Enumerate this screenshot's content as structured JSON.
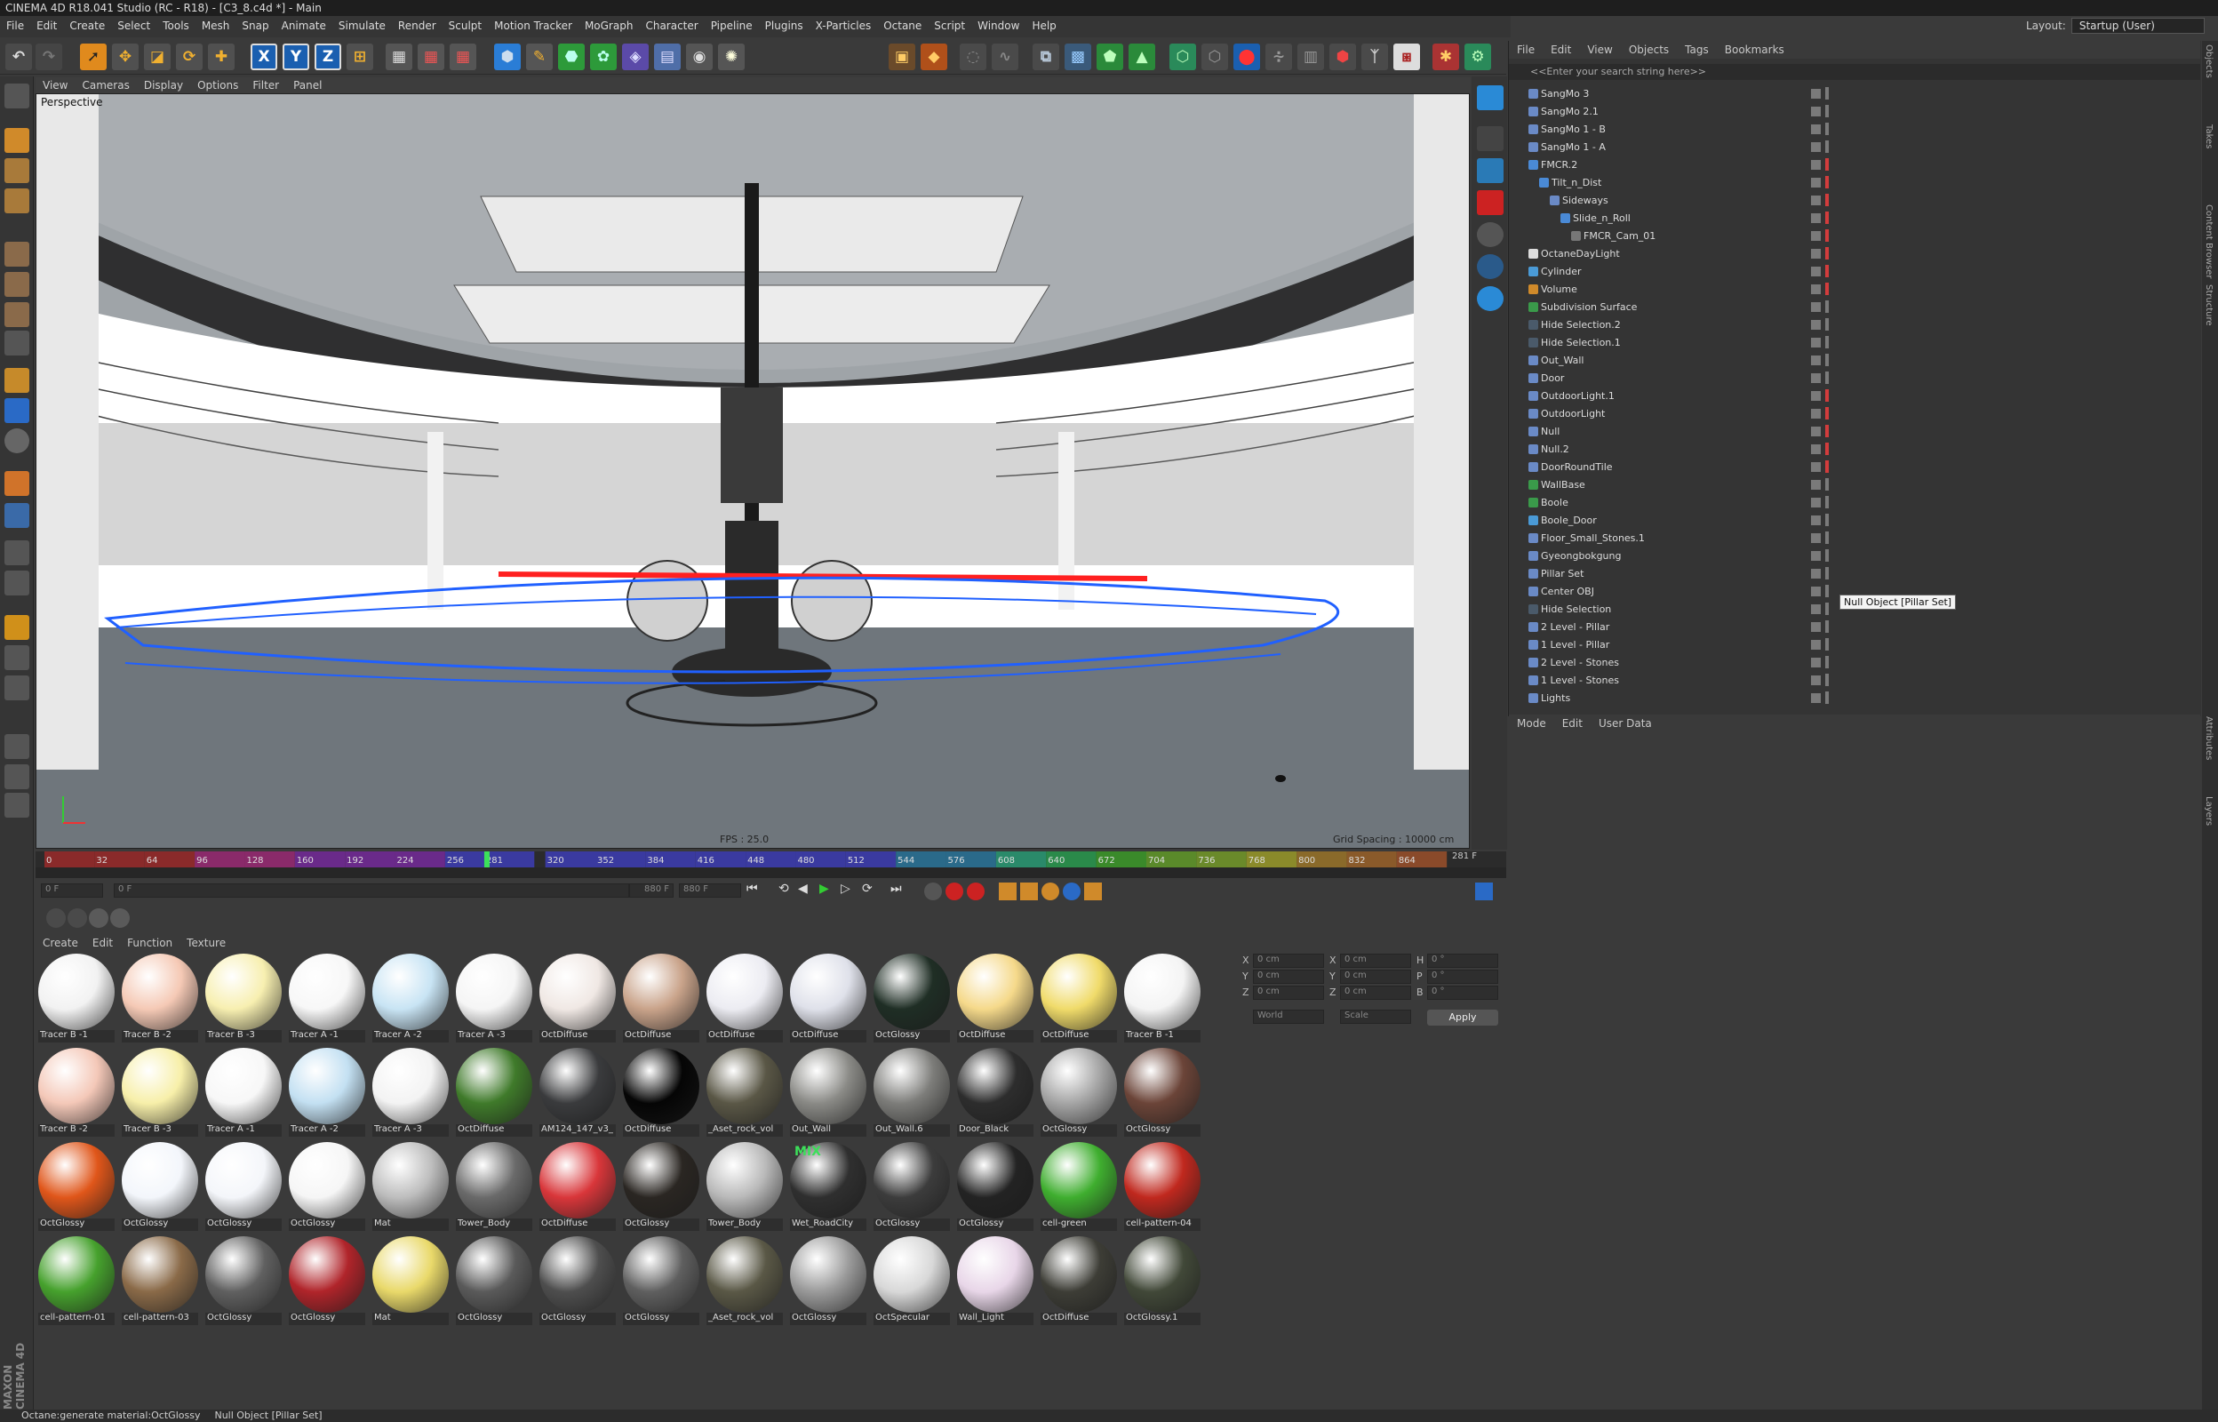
{
  "app": {
    "title": "CINEMA 4D R18.041 Studio (RC - R18) - [C3_8.c4d *] - Main",
    "logo": "MAXON CINEMA 4D"
  },
  "menubar": [
    "File",
    "Edit",
    "Create",
    "Select",
    "Tools",
    "Mesh",
    "Snap",
    "Animate",
    "Simulate",
    "Render",
    "Sculpt",
    "Motion Tracker",
    "MoGraph",
    "Character",
    "Pipeline",
    "Plugins",
    "X-Particles",
    "Octane",
    "Script",
    "Window",
    "Help"
  ],
  "layout": {
    "label": "Layout:",
    "value": "Startup (User)"
  },
  "viewport": {
    "menu": [
      "View",
      "Cameras",
      "Display",
      "Options",
      "Filter",
      "Panel"
    ],
    "camera_label": "Perspective",
    "fps": "FPS : 25.0",
    "grid_spacing": "Grid Spacing : 10000 cm"
  },
  "timeline": {
    "ticks": [
      "0",
      "32",
      "64",
      "96",
      "128",
      "160",
      "192",
      "224",
      "256",
      "281",
      "320",
      "352",
      "384",
      "416",
      "448",
      "480",
      "512",
      "544",
      "576",
      "608",
      "640",
      "672",
      "704",
      "736",
      "768",
      "800",
      "832",
      "864"
    ],
    "current": "281 F",
    "start_field": "0 F",
    "min_field": "0 F",
    "max_field": "880 F",
    "end_field": "880 F"
  },
  "materials": {
    "menu": [
      "Create",
      "Edit",
      "Function",
      "Texture"
    ],
    "items": [
      {
        "label": "Tracer B -1",
        "color": "#f2f2f2"
      },
      {
        "label": "Tracer B -2",
        "color": "#f5c9b5"
      },
      {
        "label": "Tracer B -3",
        "color": "#f7efb0"
      },
      {
        "label": "Tracer A -1",
        "color": "#f7f7f7"
      },
      {
        "label": "Tracer A -2",
        "color": "#c8e4f4"
      },
      {
        "label": "Tracer A -3",
        "color": "#f5f5f5"
      },
      {
        "label": "OctDiffuse",
        "color": "#f0e8e4"
      },
      {
        "label": "OctDiffuse",
        "color": "#c9a38a"
      },
      {
        "label": "OctDiffuse",
        "color": "#ececf2"
      },
      {
        "label": "OctDiffuse",
        "color": "#dfe1ea"
      },
      {
        "label": "OctGlossy",
        "color": "#1f2e25"
      },
      {
        "label": "OctDiffuse",
        "color": "#f5d98a"
      },
      {
        "label": "OctDiffuse",
        "color": "#f0db6a"
      },
      {
        "label": "Tracer B -1",
        "color": "#f4f4f4"
      },
      {
        "label": "Tracer B -2",
        "color": "#f4c8b8"
      },
      {
        "label": "Tracer B -3",
        "color": "#f7efa9"
      },
      {
        "label": "Tracer A -1",
        "color": "#f7f7f7"
      },
      {
        "label": "Tracer A -2",
        "color": "#c3e0f2"
      },
      {
        "label": "Tracer A -3",
        "color": "#f3f3f3"
      },
      {
        "label": "OctDiffuse",
        "color": "#3f7a2a"
      },
      {
        "label": "AM124_147_v3_",
        "color": "#3a3b3d"
      },
      {
        "label": "OctDiffuse",
        "color": "#050505"
      },
      {
        "label": "_Aset_rock_vol",
        "color": "#5a5746"
      },
      {
        "label": "Out_Wall",
        "color": "#8a8a86"
      },
      {
        "label": "Out_Wall.6",
        "color": "#7d7d7a"
      },
      {
        "label": "Door_Black",
        "color": "#2d2d2d"
      },
      {
        "label": "OctGlossy",
        "color": "#a5a5a5"
      },
      {
        "label": "OctGlossy",
        "color": "#6b4438"
      },
      {
        "label": "OctGlossy",
        "color": "#e0561a"
      },
      {
        "label": "OctGlossy",
        "color": "#f3f6fb"
      },
      {
        "label": "OctGlossy",
        "color": "#f4f6fa"
      },
      {
        "label": "OctGlossy",
        "color": "#f6f6f6"
      },
      {
        "label": "Mat",
        "color": "#bdbdbd"
      },
      {
        "label": "Tower_Body",
        "color": "#6a6a6a"
      },
      {
        "label": "OctDiffuse",
        "color": "#d9363a"
      },
      {
        "label": "OctGlossy",
        "color": "#2a2622"
      },
      {
        "label": "Tower_Body",
        "color": "#b9b9b9"
      },
      {
        "label": "Wet_RoadCity",
        "color": "#2f2f2f"
      },
      {
        "label": "OctGlossy",
        "color": "#3c3c3c"
      },
      {
        "label": "OctGlossy",
        "color": "#232323"
      },
      {
        "label": "cell-green",
        "color": "#3fae2f"
      },
      {
        "label": "cell-pattern-04",
        "color": "#c0281e"
      },
      {
        "label": "cell-pattern-01",
        "color": "#46a12d"
      },
      {
        "label": "cell-pattern-03",
        "color": "#8a6a48"
      },
      {
        "label": "OctGlossy",
        "color": "#606060"
      },
      {
        "label": "OctGlossy",
        "color": "#b0242a"
      },
      {
        "label": "Mat",
        "color": "#e9d96a"
      },
      {
        "label": "OctGlossy",
        "color": "#5a5a5a"
      },
      {
        "label": "OctGlossy",
        "color": "#4e4e4e"
      },
      {
        "label": "OctGlossy",
        "color": "#5f5f5f"
      },
      {
        "label": "_Aset_rock_vol",
        "color": "#5a5846"
      },
      {
        "label": "OctGlossy",
        "color": "#9a9a9a"
      },
      {
        "label": "OctSpecular",
        "color": "#d8d8d8"
      },
      {
        "label": "Wall_Light",
        "color": "#e8d6e8"
      },
      {
        "label": "OctDiffuse",
        "color": "#3d3d36"
      },
      {
        "label": "OctGlossy.1",
        "color": "#414838"
      }
    ],
    "mix_label": "MIX"
  },
  "coords": {
    "labels": {
      "x": "X",
      "y": "Y",
      "z": "Z",
      "h": "H",
      "p": "P",
      "b": "B"
    },
    "pos": [
      "0 cm",
      "0 cm",
      "0 cm"
    ],
    "size": [
      "0 cm",
      "0 cm",
      "0 cm"
    ],
    "rot": [
      "0 °",
      "0 °",
      "0 °"
    ],
    "world": "World",
    "scale": "Scale",
    "apply": "Apply"
  },
  "objects": {
    "menu": [
      "File",
      "Edit",
      "View",
      "Objects",
      "Tags",
      "Bookmarks"
    ],
    "search_placeholder": "<<Enter your search string here>>",
    "rows": [
      {
        "name": "SangMo 3",
        "indent": 0,
        "icon": "L0",
        "dot": "#7a7a7a"
      },
      {
        "name": "SangMo 2.1",
        "indent": 0,
        "icon": "L0",
        "dot": "#7a7a7a"
      },
      {
        "name": "SangMo 1 - B",
        "indent": 0,
        "icon": "L0",
        "dot": "#7a7a7a"
      },
      {
        "name": "SangMo 1 - A",
        "indent": 0,
        "icon": "L0",
        "dot": "#7a7a7a"
      },
      {
        "name": "FMCR.2",
        "indent": 0,
        "icon": "spline",
        "dot": "#d23c3c"
      },
      {
        "name": "Tilt_n_Dist",
        "indent": 1,
        "icon": "spline",
        "dot": "#d23c3c"
      },
      {
        "name": "Sideways",
        "indent": 2,
        "icon": "L0",
        "dot": "#d23c3c"
      },
      {
        "name": "Slide_n_Roll",
        "indent": 3,
        "icon": "spline",
        "dot": "#d23c3c"
      },
      {
        "name": "FMCR_Cam_01",
        "indent": 4,
        "icon": "camera",
        "dot": "#d23c3c"
      },
      {
        "name": "OctaneDayLight",
        "indent": 0,
        "icon": "light",
        "dot": "#d23c3c"
      },
      {
        "name": "Cylinder",
        "indent": 0,
        "icon": "prim",
        "dot": "#d23c3c"
      },
      {
        "name": "Volume",
        "indent": 0,
        "icon": "volume",
        "dot": "#d23c3c"
      },
      {
        "name": "Subdivision Surface",
        "indent": 0,
        "icon": "green",
        "dot": "#7a7a7a"
      },
      {
        "name": "Hide Selection.2",
        "indent": 0,
        "icon": "dark",
        "dot": "#7a7a7a"
      },
      {
        "name": "Hide Selection.1",
        "indent": 0,
        "icon": "dark",
        "dot": "#7a7a7a"
      },
      {
        "name": "Out_Wall",
        "indent": 0,
        "icon": "L0",
        "dot": "#7a7a7a"
      },
      {
        "name": "Door",
        "indent": 0,
        "icon": "L0",
        "dot": "#7a7a7a"
      },
      {
        "name": "OutdoorLight.1",
        "indent": 0,
        "icon": "L0",
        "dot": "#d23c3c"
      },
      {
        "name": "OutdoorLight",
        "indent": 0,
        "icon": "L0",
        "dot": "#d23c3c"
      },
      {
        "name": "Null",
        "indent": 0,
        "icon": "L0",
        "dot": "#d23c3c"
      },
      {
        "name": "Null.2",
        "indent": 0,
        "icon": "L0",
        "dot": "#d23c3c"
      },
      {
        "name": "DoorRoundTile",
        "indent": 0,
        "icon": "L0",
        "dot": "#d23c3c"
      },
      {
        "name": "WallBase",
        "indent": 0,
        "icon": "green",
        "dot": "#7a7a7a"
      },
      {
        "name": "Boole",
        "indent": 0,
        "icon": "green",
        "dot": "#7a7a7a"
      },
      {
        "name": "Boole_Door",
        "indent": 0,
        "icon": "prim",
        "dot": "#7a7a7a"
      },
      {
        "name": "Floor_Small_Stones.1",
        "indent": 0,
        "icon": "L0",
        "dot": "#7a7a7a"
      },
      {
        "name": "Gyeongbokgung",
        "indent": 0,
        "icon": "L0",
        "dot": "#7a7a7a"
      },
      {
        "name": "Pillar Set",
        "indent": 0,
        "icon": "L0",
        "dot": "#7a7a7a"
      },
      {
        "name": "Center OBJ",
        "indent": 0,
        "icon": "L0",
        "dot": "#7a7a7a"
      },
      {
        "name": "Hide Selection",
        "indent": 0,
        "icon": "dark",
        "dot": "#7a7a7a"
      },
      {
        "name": "2 Level - Pillar",
        "indent": 0,
        "icon": "L0",
        "dot": "#7a7a7a"
      },
      {
        "name": "1 Level - Pillar",
        "indent": 0,
        "icon": "L0",
        "dot": "#7a7a7a"
      },
      {
        "name": "2 Level - Stones",
        "indent": 0,
        "icon": "L0",
        "dot": "#7a7a7a"
      },
      {
        "name": "1 Level - Stones",
        "indent": 0,
        "icon": "L0",
        "dot": "#7a7a7a"
      },
      {
        "name": "Lights",
        "indent": 0,
        "icon": "L0",
        "dot": "#7a7a7a"
      }
    ],
    "tooltip": "Null Object [Pillar Set]"
  },
  "attributes": {
    "menu": [
      "Mode",
      "Edit",
      "User Data"
    ]
  },
  "right_tabs": [
    "Objects",
    "Takes",
    "Content Browser",
    "Structure",
    "Attributes",
    "Layers"
  ],
  "status": {
    "left": "Octane:generate material:OctGlossy",
    "right": "Null Object [Pillar Set]"
  },
  "toolbar_icons": [
    "undo-icon",
    "redo-icon",
    "live-select-icon",
    "move-icon",
    "scale-icon",
    "rotate-icon",
    "recent-tools-icon",
    "x-axis-icon",
    "y-axis-icon",
    "z-axis-icon",
    "coord-system-icon",
    "render-view-icon",
    "render-region-icon",
    "render-settings-icon",
    "cube-icon",
    "pen-icon",
    "subdivision-icon",
    "array-icon",
    "deformer-icon",
    "floor-icon",
    "camera-icon",
    "light-icon"
  ],
  "axis_labels": {
    "x": "X",
    "y": "Y",
    "z": "Z"
  }
}
